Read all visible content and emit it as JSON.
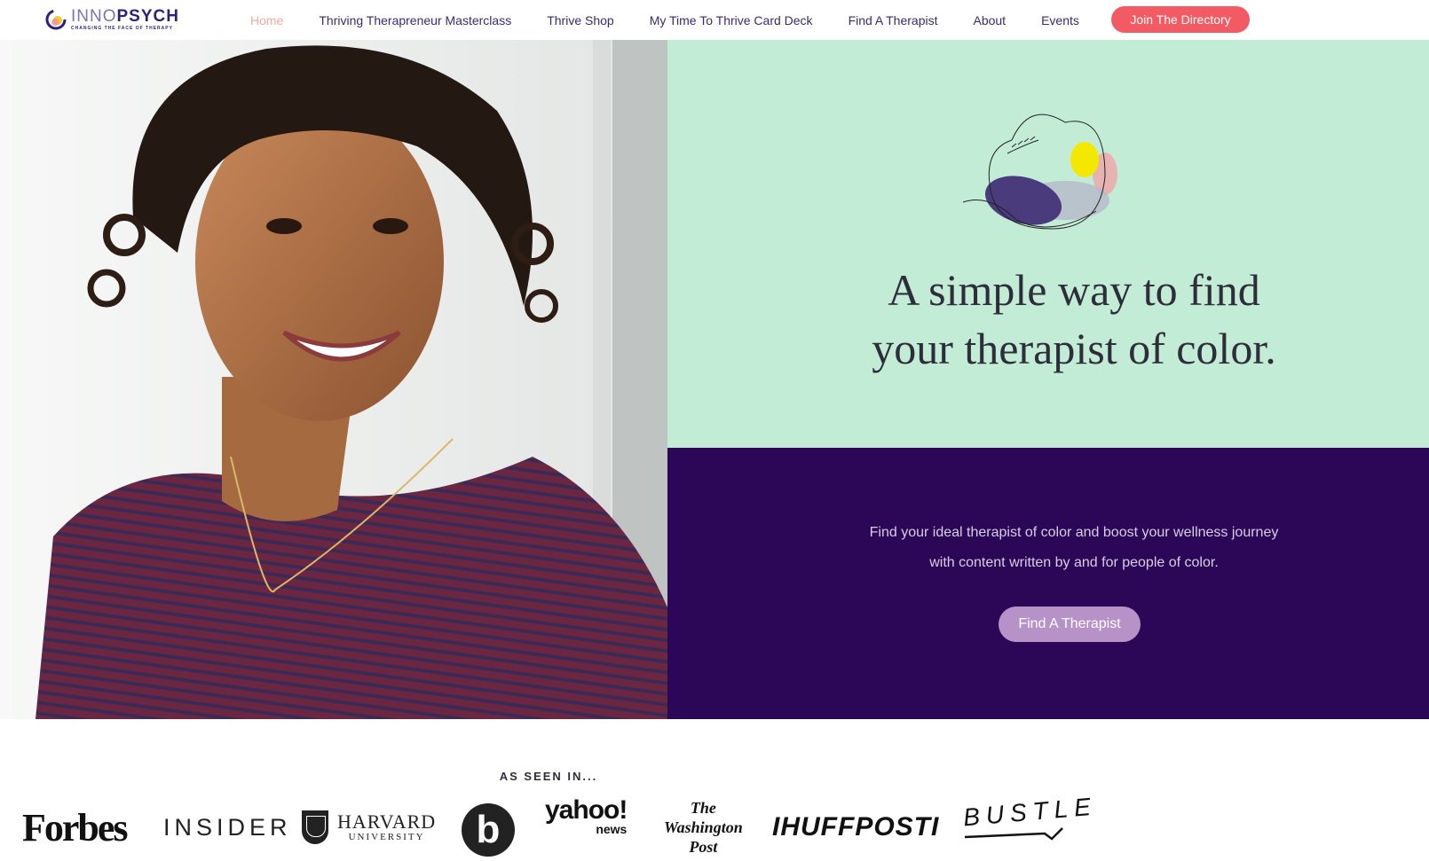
{
  "header": {
    "logo": {
      "word_inno": "INNO",
      "word_psych": "PSYCH",
      "tagline": "CHANGING THE FACE OF THERAPY"
    },
    "nav": [
      {
        "label": "Home",
        "active": true
      },
      {
        "label": "Thriving Therapreneur Masterclass"
      },
      {
        "label": "Thrive Shop"
      },
      {
        "label": "My Time To Thrive Card Deck"
      },
      {
        "label": "Find A Therapist"
      },
      {
        "label": "About"
      },
      {
        "label": "Events"
      }
    ],
    "join_button": "Join The Directory"
  },
  "hero": {
    "headline_line1": "A simple way to find",
    "headline_line2": "your therapist of color.",
    "subtext_line1": "Find your ideal therapist of color and boost your wellness journey",
    "subtext_line2": "with content written by and for people of color.",
    "cta_button": "Find A Therapist"
  },
  "press": {
    "label": "AS SEEN IN...",
    "forbes": "Forbes",
    "insider": "INSIDER",
    "harvard_big": "HARVARD",
    "harvard_small": "UNIVERSITY",
    "bustle_b": "b",
    "yahoo_big": "yahoo!",
    "yahoo_small": "news",
    "wapo_1": "The",
    "wapo_2": "Washington",
    "wapo_3": "Post",
    "huffpost": "IHUFFPOSTI",
    "bustle": "BUSTLE"
  },
  "colors": {
    "accent": "#f25a64",
    "mint": "#c3ecd7",
    "purple": "#2d0757",
    "cta": "#b792c8",
    "nav_text": "#3b2a6e",
    "nav_active": "#f4a9a2"
  }
}
